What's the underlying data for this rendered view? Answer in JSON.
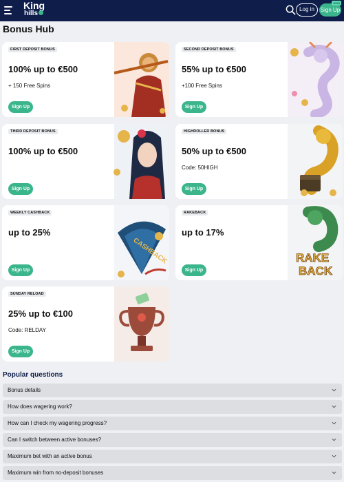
{
  "header": {
    "logo_line1": "King",
    "logo_line2": "hills",
    "login_label": "Log in",
    "signup_label": "Sign Up",
    "signup_badge": "100%"
  },
  "page_title": "Bonus Hub",
  "cards": [
    {
      "tag": "FIRST DEPOSIT BONUS",
      "headline": "100% up to €500",
      "sub": "+ 150 Free Spins",
      "button": "Sign Up",
      "art_icon": "monkey-king-icon"
    },
    {
      "tag": "SECOND DEPOSIT BONUS",
      "headline": "55% up to €500",
      "sub": "+100 Free Spins",
      "button": "Sign Up",
      "art_icon": "dragon-icon"
    },
    {
      "tag": "THIRD DEPOSIT BONUS",
      "headline": "100% up to €500",
      "sub": "",
      "button": "Sign Up",
      "art_icon": "geisha-icon"
    },
    {
      "tag": "HIGHROLLER BONUS",
      "headline": "50% up to €500",
      "sub": "Code: 50HIGH",
      "button": "Sign Up",
      "art_icon": "golden-dragon-icon"
    },
    {
      "tag": "WEEKLY CASHBACK",
      "headline": "up to 25%",
      "sub": "",
      "button": "Sign Up",
      "art_icon": "cashback-fan-icon"
    },
    {
      "tag": "RAKEBACK",
      "headline": "up to 17%",
      "sub": "",
      "button": "Sign Up",
      "art_icon": "rakeback-dragon-icon"
    },
    {
      "tag": "SUNDAY RELOAD",
      "headline": "25% up to €100",
      "sub": "Code: RELDAY",
      "button": "Sign Up",
      "art_icon": "trophy-icon"
    }
  ],
  "art_text": {
    "cashback": "CASHBACK",
    "rake": "RAKE",
    "back": "BACK"
  },
  "faq": {
    "title": "Popular questions",
    "items": [
      "Bonus details",
      "How does wagering work?",
      "How can I check my wagering progress?",
      "Can I switch between active bonuses?",
      "Maximum bet with an active bonus",
      "Maximum win from no-deposit bonuses"
    ]
  },
  "colors": {
    "header_bg": "#0f1d4a",
    "accent_green": "#3bb58c",
    "page_bg": "#eef0f3",
    "faq_item_bg": "#dcdee2"
  }
}
